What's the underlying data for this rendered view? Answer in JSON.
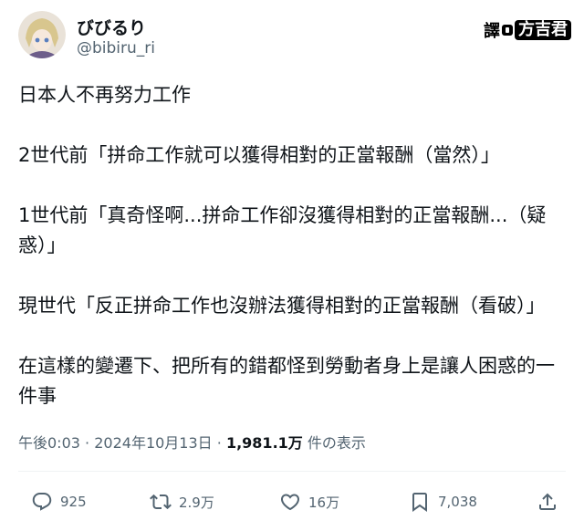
{
  "user": {
    "name": "びびるり",
    "handle": "@bibiru_ri"
  },
  "watermark": {
    "prefix": "譯",
    "brand": "方吉君"
  },
  "post": {
    "paragraphs": [
      "日本人不再努力工作",
      "2世代前「拼命工作就可以獲得相對的正當報酬（當然）」",
      "1世代前「真奇怪啊...拼命工作卻沒獲得相對的正當報酬...（疑惑）」",
      "現世代「反正拼命工作也沒辦法獲得相對的正當報酬（看破）」",
      "在這樣的變遷下、把所有的錯都怪到勞動者身上是讓人困惑的一件事"
    ]
  },
  "meta": {
    "time": "午後0:03",
    "separator": "·",
    "date": "2024年10月13日",
    "views_count": "1,981.1万",
    "views_label": "件の表示"
  },
  "actions": {
    "replies": "925",
    "reposts": "2.9万",
    "likes": "16万",
    "bookmarks": "7,038"
  },
  "colors": {
    "text_primary": "#0f1419",
    "text_secondary": "#536471",
    "divider": "#eff3f4"
  },
  "icons": {
    "reply": "reply-icon",
    "repost": "repost-icon",
    "like": "like-icon",
    "bookmark": "bookmark-icon",
    "share": "share-icon"
  }
}
